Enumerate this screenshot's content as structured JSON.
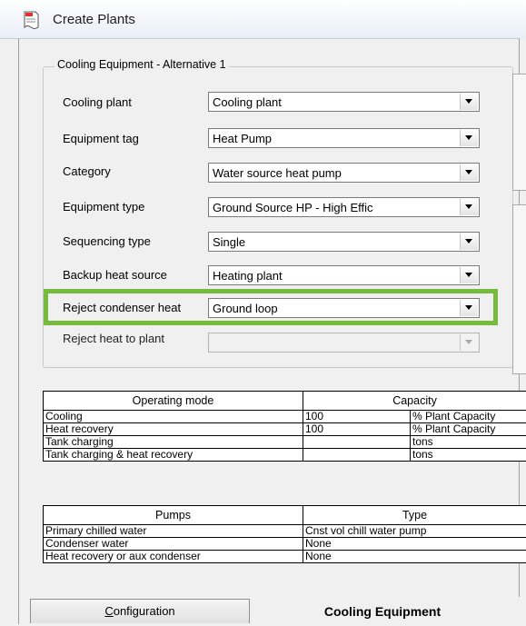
{
  "window": {
    "title": "Create Plants"
  },
  "groupbox": {
    "legend": "Cooling Equipment - Alternative 1"
  },
  "fields": [
    {
      "label": "Cooling plant",
      "value": "Cooling plant"
    },
    {
      "label": "Equipment tag",
      "value": "Heat Pump"
    },
    {
      "label": "Category",
      "value": "Water source heat pump"
    },
    {
      "label": "Equipment type",
      "value": "Ground Source HP - High Effic"
    },
    {
      "label": "Sequencing type",
      "value": "Single"
    },
    {
      "label": "Backup heat source",
      "value": "Heating plant"
    },
    {
      "label": "Reject condenser heat",
      "value": "Ground loop"
    },
    {
      "label": "Reject heat to plant",
      "value": ""
    }
  ],
  "highlight_color": "#76bb3e",
  "operating_table": {
    "headers": [
      "Operating mode",
      "Capacity"
    ],
    "rows": [
      {
        "mode": "Cooling",
        "value": "100",
        "unit": "% Plant Capacity"
      },
      {
        "mode": "Heat recovery",
        "value": "100",
        "unit": "% Plant Capacity"
      },
      {
        "mode": "Tank charging",
        "value": "",
        "unit": "tons"
      },
      {
        "mode": "Tank charging & heat recovery",
        "value": "",
        "unit": "tons"
      }
    ]
  },
  "pumps_table": {
    "headers": [
      "Pumps",
      "Type"
    ],
    "rows": [
      {
        "pump": "Primary chilled water",
        "type": "Cnst vol chill water pump"
      },
      {
        "pump": "Condenser water",
        "type": "None"
      },
      {
        "pump": "Heat recovery or aux condenser",
        "type": "None"
      }
    ]
  },
  "tabs": {
    "configuration": {
      "first_letter": "C",
      "rest": "onfiguration"
    },
    "cooling_equipment": "Cooling Equipment"
  }
}
